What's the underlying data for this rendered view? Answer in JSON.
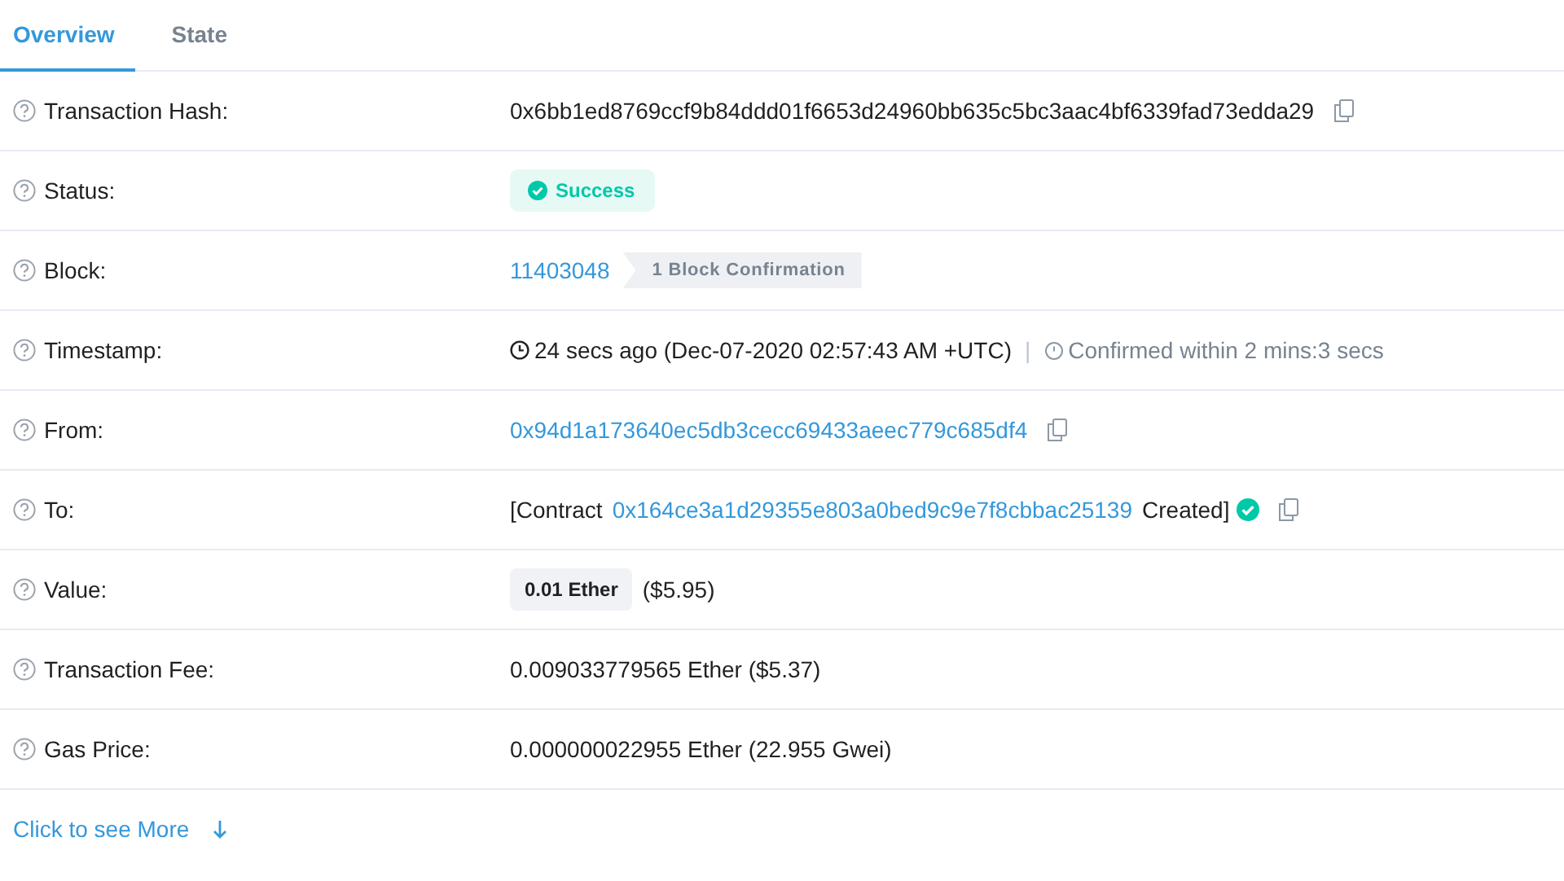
{
  "tabs": [
    {
      "label": "Overview",
      "selected": true
    },
    {
      "label": "State",
      "selected": false
    }
  ],
  "rows": [
    {
      "label": "Transaction Hash:",
      "value": [
        {
          "kind": "text",
          "text": "0x6bb1ed8769ccf9b84ddd01f6653d24960bb635c5bc3aac4bf6339fad73edda29"
        },
        {
          "kind": "copy"
        }
      ]
    },
    {
      "label": "Status:",
      "value": [
        {
          "kind": "status",
          "text": "Success"
        }
      ]
    },
    {
      "label": "Block:",
      "value": [
        {
          "kind": "link",
          "text": "11403048"
        },
        {
          "kind": "tag",
          "text": "1 Block Confirmation"
        }
      ]
    },
    {
      "label": "Timestamp:",
      "value": [
        {
          "kind": "clock",
          "text": "24 secs ago (Dec-07-2020 02:57:43 AM +UTC)"
        },
        {
          "kind": "divider",
          "text": "|"
        },
        {
          "kind": "timer",
          "text": "Confirmed within 2 mins:3 secs"
        }
      ]
    },
    {
      "label": "From:",
      "value": [
        {
          "kind": "link",
          "text": "0x94d1a173640ec5db3cecc69433aeec779c685df4"
        },
        {
          "kind": "copy"
        }
      ]
    },
    {
      "label": "To:",
      "value": [
        {
          "kind": "text",
          "text": "[Contract"
        },
        {
          "kind": "link",
          "text": "0x164ce3a1d29355e803a0bed9c9e7f8cbbac25139"
        },
        {
          "kind": "text",
          "text": "Created]"
        },
        {
          "kind": "verified"
        },
        {
          "kind": "copy"
        }
      ]
    },
    {
      "label": "Value:",
      "value": [
        {
          "kind": "pill",
          "text": "0.01 Ether"
        },
        {
          "kind": "text",
          "text": "($5.95)"
        }
      ]
    },
    {
      "label": "Transaction Fee:",
      "value": [
        {
          "kind": "text",
          "text": "0.009033779565 Ether ($5.37)"
        }
      ]
    },
    {
      "label": "Gas Price:",
      "value": [
        {
          "kind": "text",
          "text": "0.000000022955 Ether (22.955 Gwei)"
        }
      ]
    }
  ],
  "more_link": "Click to see More"
}
